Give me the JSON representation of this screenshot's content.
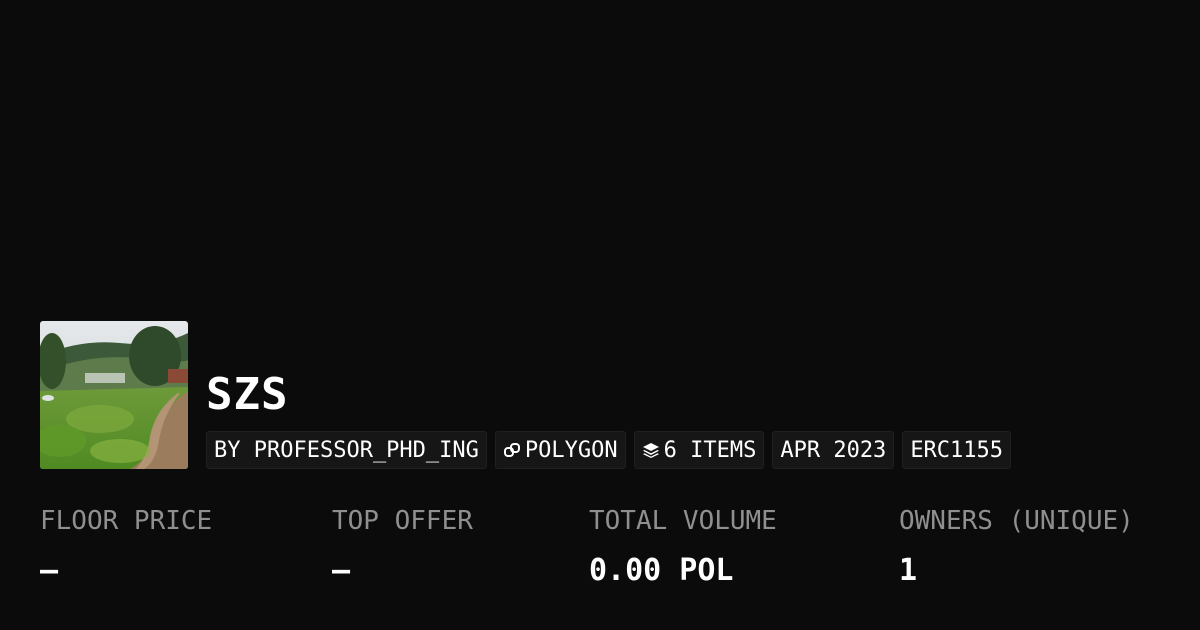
{
  "collection": {
    "title": "SZS",
    "creator": "BY PROFESSOR_PHD_ING",
    "chain": "POLYGON",
    "chain_icon": "polygon-link-icon",
    "items": "6 ITEMS",
    "items_icon": "layers-icon",
    "date": "APR 2023",
    "standard": "ERC1155"
  },
  "stats": [
    {
      "label": "FLOOR PRICE",
      "value": "—"
    },
    {
      "label": "TOP OFFER",
      "value": "—"
    },
    {
      "label": "TOTAL VOLUME",
      "value": "0.00 POL"
    },
    {
      "label": "OWNERS (UNIQUE)",
      "value": "1"
    }
  ],
  "colors": {
    "background": "#0b0b0b",
    "chip_background": "#161616",
    "label_gray": "#8f8f8f",
    "text": "#ffffff"
  }
}
